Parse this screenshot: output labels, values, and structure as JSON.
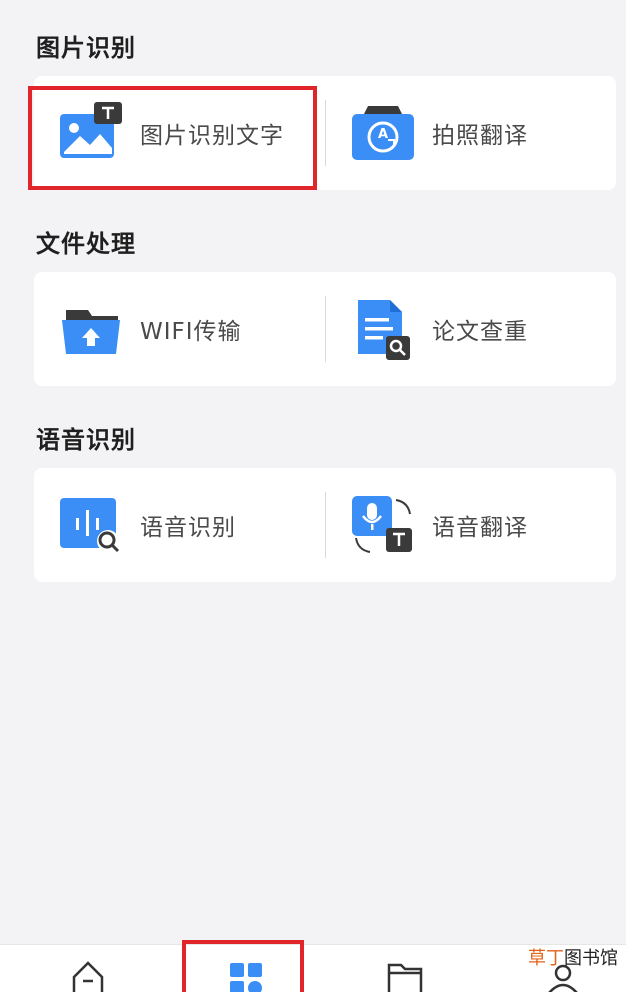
{
  "sections": [
    {
      "title": "图片识别",
      "tools": [
        {
          "label": "图片识别文字",
          "icon": "image-ocr-icon"
        },
        {
          "label": "拍照翻译",
          "icon": "photo-translate-icon"
        }
      ]
    },
    {
      "title": "文件处理",
      "tools": [
        {
          "label": "WIFI传输",
          "icon": "wifi-transfer-folder-icon"
        },
        {
          "label": "论文查重",
          "icon": "paper-check-icon"
        }
      ]
    },
    {
      "title": "语音识别",
      "tools": [
        {
          "label": "语音识别",
          "icon": "voice-recognition-icon"
        },
        {
          "label": "语音翻译",
          "icon": "voice-translate-icon"
        }
      ]
    }
  ],
  "tabbar": {
    "tabs": [
      {
        "icon": "home-icon"
      },
      {
        "icon": "tools-grid-icon",
        "selected": true
      },
      {
        "icon": "folder-icon"
      },
      {
        "icon": "profile-icon"
      }
    ]
  },
  "watermark": {
    "accent": "草丁",
    "rest": "图书馆"
  },
  "colors": {
    "accent": "#3a8ef6",
    "highlight": "#e0262b",
    "background": "#f3f3f6",
    "dark_badge": "#3a3a3a"
  }
}
